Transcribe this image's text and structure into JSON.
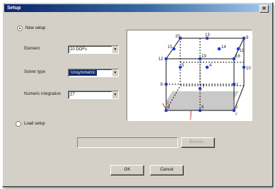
{
  "window": {
    "title": "Setup",
    "close_symbol": "✕"
  },
  "options": {
    "new_setup_label": "New setup",
    "element_label": "Element",
    "element_value": "20 DOFs",
    "solver_label": "Solver type",
    "solver_value": "Unsymmetric",
    "integration_label": "Numeric integration",
    "integration_value": "27",
    "load_label": "Load setup",
    "browse_label": "Browse..."
  },
  "diagram": {
    "node_labels": [
      "20",
      "13",
      "9",
      "15",
      "14",
      "11",
      "12",
      "19",
      "16",
      "5",
      "10",
      "4",
      "8",
      "1",
      "7",
      "3",
      "6",
      "2"
    ],
    "axis_labels": [
      "z",
      "x",
      "y"
    ]
  },
  "buttons": {
    "ok": "OK",
    "cancel": "Cancel"
  },
  "colors": {
    "node": "#1d3fd1",
    "edge": "#111111",
    "face": "#c9c9c9",
    "axis": "#cc2222"
  }
}
